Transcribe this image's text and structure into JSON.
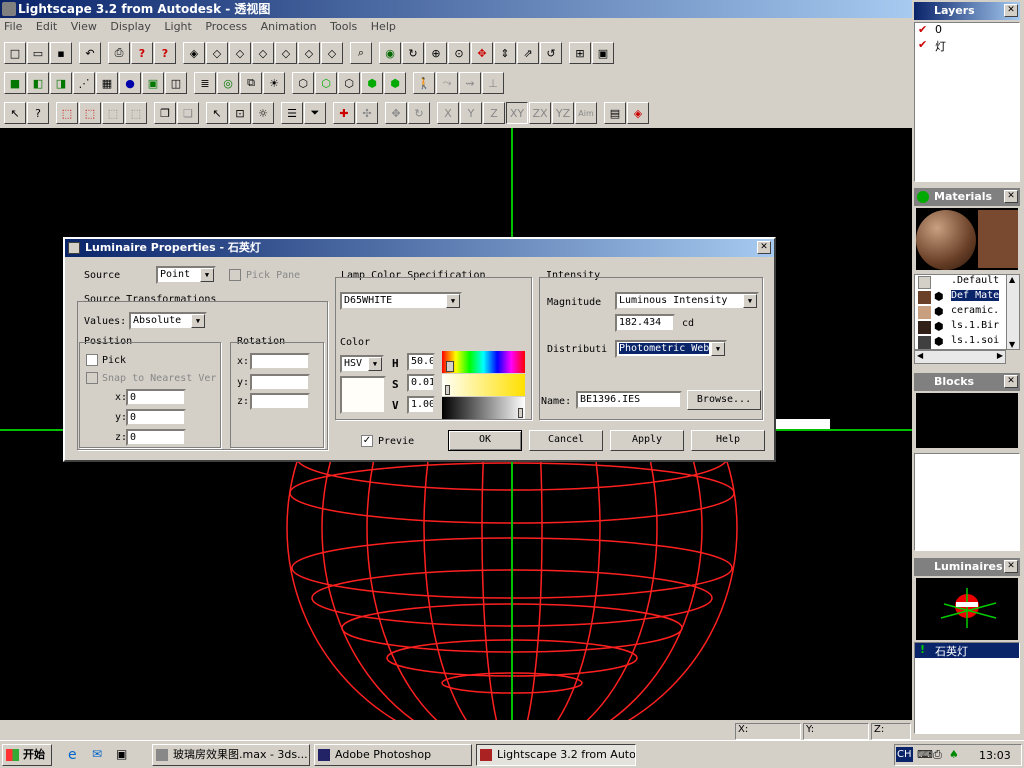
{
  "window": {
    "title": "Lightscape 3.2 from Autodesk - 透视图"
  },
  "menu": [
    "File",
    "Edit",
    "View",
    "Display",
    "Light",
    "Process",
    "Animation",
    "Tools",
    "Help"
  ],
  "axis_buttons": [
    "X",
    "Y",
    "Z",
    "XY",
    "ZX",
    "YZ",
    "Aim"
  ],
  "dialog": {
    "title": "Luminaire Properties - 石英灯",
    "source_label": "Source",
    "source_value": "Point",
    "pick_pane_label": "Pick Pane",
    "source_transformations_label": "Source Transformations",
    "values_label": "Values:",
    "values_value": "Absolute",
    "position_label": "Position",
    "pick_label": "Pick",
    "snap_label": "Snap to Nearest Ver",
    "pos": {
      "x_label": "x:",
      "x": "0",
      "y_label": "y:",
      "y": "0",
      "z_label": "z:",
      "z": "0"
    },
    "rotation_label": "Rotation",
    "rot": {
      "x_label": "x:",
      "y_label": "y:",
      "z_label": "z:"
    },
    "lamp_color_label": "Lamp Color Specification",
    "lamp_color_value": "D65WHITE",
    "color_label": "Color",
    "color_model": "HSV",
    "h_label": "H",
    "h_value": "50.0",
    "s_label": "S",
    "s_value": "0.01",
    "v_label": "V",
    "v_value": "1.00",
    "intensity_label": "Intensity",
    "magnitude_label": "Magnitude",
    "magnitude_value": "Luminous Intensity",
    "intensity_value": "182.434",
    "intensity_unit": "cd",
    "distribution_label": "Distributi",
    "distribution_value": "Photometric Web",
    "name_label": "Name:",
    "name_value": "BE1396.IES",
    "browse_label": "Browse...",
    "preview_label": "Previe",
    "ok_label": "OK",
    "cancel_label": "Cancel",
    "apply_label": "Apply",
    "help_label": "Help"
  },
  "panels": {
    "layers": {
      "title": "Layers",
      "items": [
        "0",
        "灯"
      ]
    },
    "materials": {
      "title": "Materials",
      "items": [
        ".Default",
        "Def Mate",
        "ceramic.",
        "ls.1.Bir",
        "ls.1.soi"
      ]
    },
    "blocks": {
      "title": "Blocks"
    },
    "luminaires": {
      "title": "Luminaires",
      "items": [
        "石英灯"
      ]
    }
  },
  "statusbar": {
    "x_label": "X:",
    "y_label": "Y:",
    "z_label": "Z:"
  },
  "taskbar": {
    "start_label": "开始",
    "tasks": [
      "玻璃房效果图.max - 3ds...",
      "Adobe Photoshop",
      "Lightscape 3.2 from Auto..."
    ],
    "lang": "CH",
    "clock": "13:03"
  },
  "colors": {
    "viewport_bg": "#000000",
    "wireframe": "#ff0000",
    "axis": "#00c000",
    "selection": "#0a246a"
  }
}
